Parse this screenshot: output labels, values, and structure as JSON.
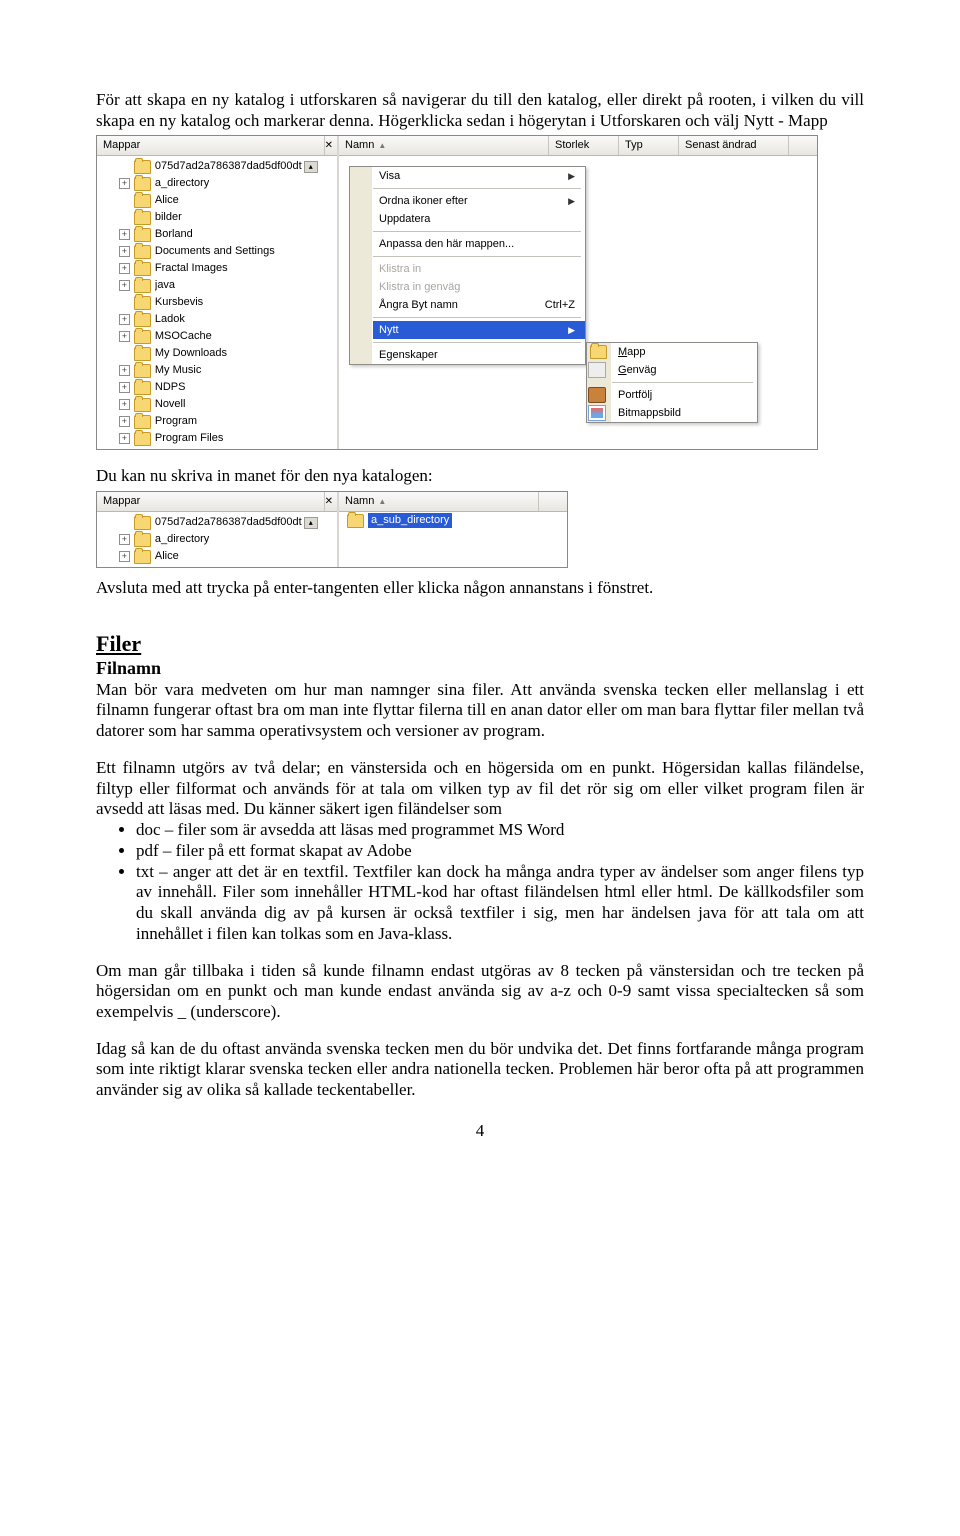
{
  "para1": "För att skapa en ny katalog i utforskaren så navigerar du till den katalog, eller direkt på rooten, i vilken du vill skapa en ny katalog och markerar denna. Högerklicka sedan i högerytan i Utforskaren och välj Nytt - Mapp",
  "shot1": {
    "left_header": "Mappar",
    "cols": [
      "Namn",
      "Storlek",
      "Typ",
      "Senast ändrad"
    ],
    "tree": [
      {
        "pre": "   ",
        "exp": "",
        "name": "075d7ad2a786387dad5df00dt",
        "up": true
      },
      {
        "pre": "   ",
        "exp": "+",
        "name": "a_directory"
      },
      {
        "pre": "   ",
        "exp": "",
        "name": "Alice"
      },
      {
        "pre": "   ",
        "exp": "",
        "name": "bilder"
      },
      {
        "pre": "   ",
        "exp": "+",
        "name": "Borland"
      },
      {
        "pre": "   ",
        "exp": "+",
        "name": "Documents and Settings"
      },
      {
        "pre": "   ",
        "exp": "+",
        "name": "Fractal Images"
      },
      {
        "pre": "   ",
        "exp": "+",
        "name": "java"
      },
      {
        "pre": "   ",
        "exp": "",
        "name": "Kursbevis"
      },
      {
        "pre": "   ",
        "exp": "+",
        "name": "Ladok"
      },
      {
        "pre": "   ",
        "exp": "+",
        "name": "MSOCache"
      },
      {
        "pre": "   ",
        "exp": "",
        "name": "My Downloads"
      },
      {
        "pre": "   ",
        "exp": "+",
        "name": "My Music"
      },
      {
        "pre": "   ",
        "exp": "+",
        "name": "NDPS"
      },
      {
        "pre": "   ",
        "exp": "+",
        "name": "Novell"
      },
      {
        "pre": "   ",
        "exp": "+",
        "name": "Program"
      },
      {
        "pre": "   ",
        "exp": "+",
        "name": "Program Files"
      }
    ],
    "ctx": {
      "items": [
        {
          "t": "Visa",
          "sub": true
        },
        "sep",
        {
          "t": "Ordna ikoner efter",
          "sub": true
        },
        {
          "t": "Uppdatera"
        },
        "sep",
        {
          "t": "Anpassa den här mappen..."
        },
        "sep",
        {
          "t": "Klistra in",
          "dis": true
        },
        {
          "t": "Klistra in genväg",
          "dis": true
        },
        {
          "t": "Ångra Byt namn",
          "kb": "Ctrl+Z"
        },
        "sep",
        {
          "t": "Nytt",
          "sub": true,
          "hi": true
        },
        "sep",
        {
          "t": "Egenskaper"
        }
      ],
      "sub": [
        {
          "t": "Mapp",
          "u": true,
          "ico": "folder"
        },
        {
          "t": "Genväg",
          "u": true,
          "ico": "shortcut"
        },
        "sep",
        {
          "t": "Portfölj",
          "ico": "briefcase"
        },
        {
          "t": "Bitmappsbild",
          "ico": "bmp"
        }
      ]
    }
  },
  "line2": "Du kan nu skriva in manet för den nya katalogen:",
  "shot2": {
    "left_header": "Mappar",
    "cols": [
      "Namn"
    ],
    "tree": [
      {
        "pre": "   ",
        "exp": "",
        "name": "075d7ad2a786387dad5df00dt",
        "up": true
      },
      {
        "pre": "   ",
        "exp": "+",
        "name": "a_directory"
      },
      {
        "pre": "   ",
        "exp": "+",
        "name": "Alice"
      }
    ],
    "new_item": "a_sub_directory"
  },
  "line3": "Avsluta med att trycka på enter-tangenten eller klicka någon annanstans i fönstret.",
  "h_filer": "Filer",
  "h_filnamn": "Filnamn",
  "para2": "Man bör vara medveten om hur man namnger sina filer. Att använda svenska tecken eller mellanslag i ett filnamn fungerar oftast bra om man inte flyttar filerna till en anan dator eller om man bara flyttar filer mellan två datorer som har samma operativsystem och versioner av program.",
  "para3": "Ett filnamn utgörs av två delar; en vänstersida och en högersida om en punkt. Högersidan kallas filändelse, filtyp eller filformat och används för at tala om vilken typ av fil det rör sig om eller vilket program filen är avsedd att läsas med. Du känner säkert igen filändelser som",
  "bul": [
    "doc – filer som är avsedda att läsas med programmet MS Word",
    "pdf – filer på ett format skapat av Adobe",
    "txt – anger att det är en textfil. Textfiler kan dock ha många andra typer av ändelser som anger filens typ av innehåll. Filer som innehåller HTML-kod har oftast filändelsen html eller html. De källkodsfiler som du skall använda dig av på kursen är också textfiler i sig, men har ändelsen java för att tala om att innehållet i filen kan tolkas som en Java-klass."
  ],
  "para4": "Om man går tillbaka i tiden så kunde filnamn endast utgöras av 8 tecken på vänstersidan och tre tecken på högersidan om en punkt och man kunde endast använda sig av a-z och 0-9 samt vissa specialtecken så som exempelvis _ (underscore).",
  "para5": "Idag så kan de du oftast använda svenska tecken men du bör undvika det. Det finns fortfarande många program som inte riktigt klarar svenska tecken eller andra nationella tecken. Problemen här beror ofta på att programmen använder sig av olika så kallade teckentabeller.",
  "pagenum": "4"
}
